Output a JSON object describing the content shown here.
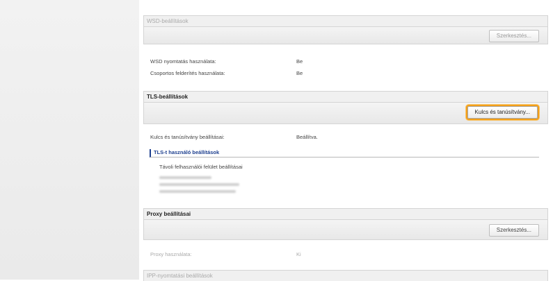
{
  "wsd": {
    "header": "WSD-beállítások",
    "edit_button": "Szerkesztés...",
    "rows": [
      {
        "label": "WSD nyomtatás használata:",
        "value": "Be"
      },
      {
        "label": "Csoportos felderítés használata:",
        "value": "Be"
      }
    ]
  },
  "tls": {
    "header": "TLS-beállítások",
    "key_button": "Kulcs és tanúsítvány...",
    "rows": [
      {
        "label": "Kulcs és tanúsítvány beállításai:",
        "value": "Beállítva."
      }
    ],
    "subheader": "TLS-t használó beállítások",
    "sub_label": "Távoli felhasználói felület beállításai"
  },
  "proxy": {
    "header": "Proxy beállításai",
    "edit_button": "Szerkesztés...",
    "rows": [
      {
        "label": "Proxy használata:",
        "value": "Ki"
      }
    ]
  },
  "ipp": {
    "header": "IPP-nyomtatási beállítások"
  },
  "colors": {
    "highlight": "#f29f1a",
    "subheader_accent": "#1d3f8f"
  }
}
